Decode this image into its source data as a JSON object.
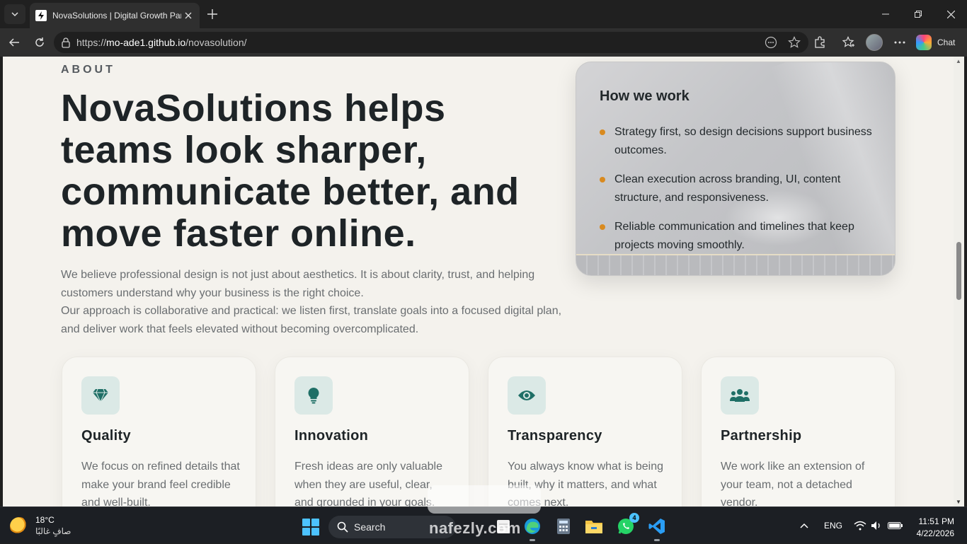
{
  "browser": {
    "tab_title": "NovaSolutions | Digital Growth Partner",
    "url_prefix": "https://",
    "url_host": "mo-ade1.github.io",
    "url_path": "/novasolution/",
    "copilot_label": "Chat"
  },
  "about": {
    "eyebrow": "ABOUT",
    "headline": "NovaSolutions helps teams look sharper, communicate better, and move faster online.",
    "lead_1": "We believe professional design is not just about aesthetics. It is about clarity, trust, and helping customers understand why your business is the right choice.",
    "lead_2": "Our approach is collaborative and practical: we listen first, translate goals into a focused digital plan, and deliver work that feels elevated without becoming overcomplicated."
  },
  "how_we_work": {
    "title": "How we work",
    "items": [
      "Strategy first, so design decisions support business outcomes.",
      "Clean execution across branding, UI, content structure, and responsiveness.",
      "Reliable communication and timelines that keep projects moving smoothly."
    ],
    "bullet_color": "#d98a1f"
  },
  "values": [
    {
      "icon": "gem-icon",
      "title": "Quality",
      "desc": "We focus on refined details that make your brand feel credible and well-built."
    },
    {
      "icon": "lightbulb-icon",
      "title": "Innovation",
      "desc": "Fresh ideas are only valuable when they are useful, clear, and grounded in your goals."
    },
    {
      "icon": "eye-icon",
      "title": "Transparency",
      "desc": "You always know what is being built, why it matters, and what comes next."
    },
    {
      "icon": "users-icon",
      "title": "Partnership",
      "desc": "We work like an extension of your team, not a detached vendor."
    }
  ],
  "theme": {
    "accent_teal": "#1f6f66",
    "icon_bg": "#dbe9e6",
    "page_bg": "#f4f2ed"
  },
  "watermark": {
    "text": "nafezly.com"
  },
  "taskbar": {
    "temperature": "18°C",
    "condition": "صافٍ غالبًا",
    "search_label": "Search",
    "whatsapp_badge": "4",
    "language": "ENG",
    "time": "11:51 PM",
    "date": "4/22/2026"
  }
}
